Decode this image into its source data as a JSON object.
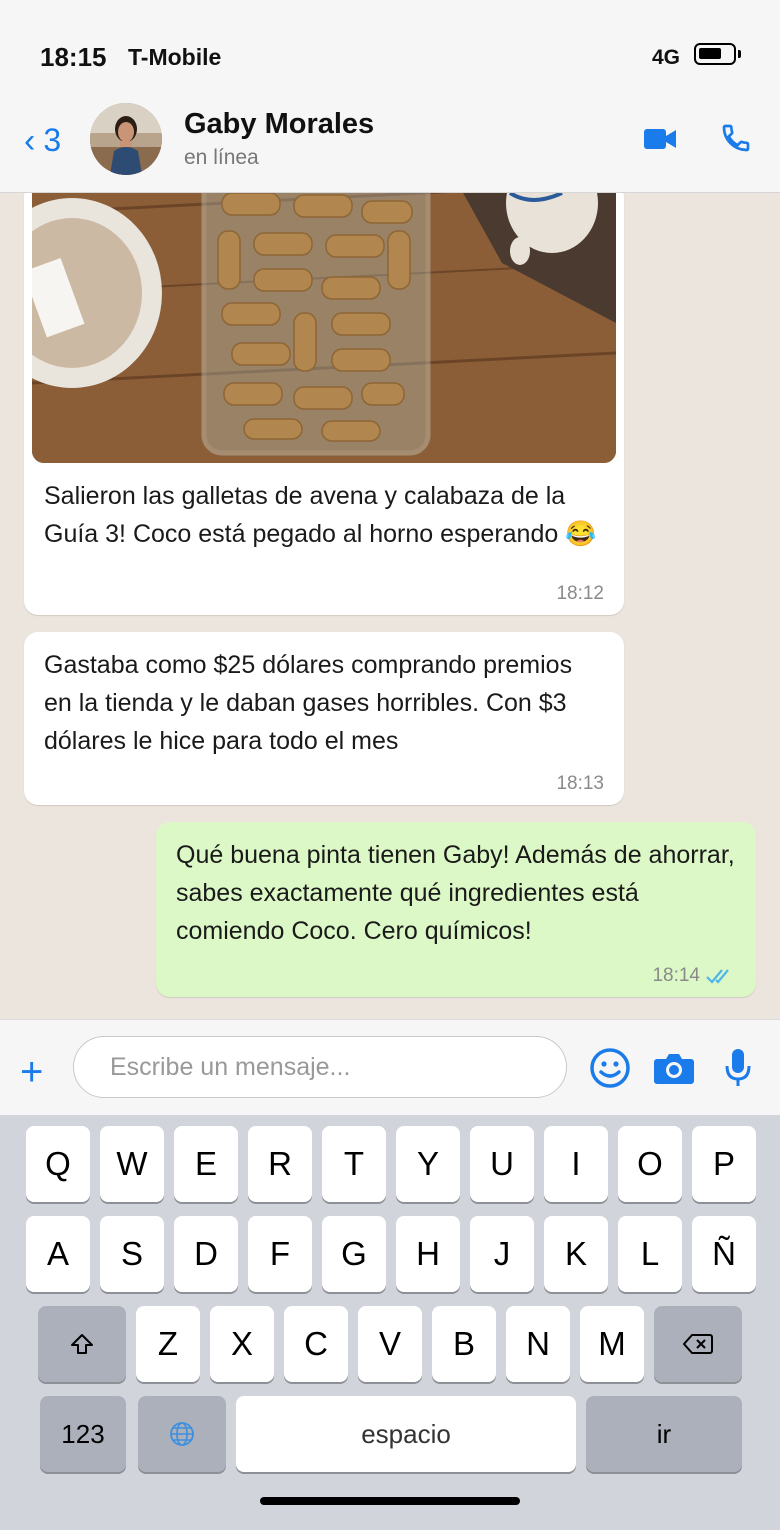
{
  "status_bar": {
    "time": "18:15",
    "carrier": "T-Mobile",
    "network": "4G"
  },
  "header": {
    "back_count": "3",
    "contact_name": "Gaby Morales",
    "contact_status": "en línea"
  },
  "messages": [
    {
      "direction": "incoming",
      "has_image": true,
      "text": "Salieron las galletas de avena y calabaza de la Guía 3! Coco está pegado al horno esperando 😂",
      "time": "18:12"
    },
    {
      "direction": "incoming",
      "text": "Gastaba como $25 dólares comprando premios en la tienda y le daban gases horribles. Con $3 dólares le hice para todo el mes",
      "time": "18:13"
    },
    {
      "direction": "outgoing",
      "text": "Qué buena pinta tienen Gaby! Además de ahorrar, sabes exactamente qué ingredientes está comiendo Coco. Cero químicos!",
      "time": "18:14",
      "read": true
    }
  ],
  "composer": {
    "placeholder": "Escribe un mensaje..."
  },
  "keyboard": {
    "row1": [
      "Q",
      "W",
      "E",
      "R",
      "T",
      "Y",
      "U",
      "I",
      "O",
      "P"
    ],
    "row2": [
      "A",
      "S",
      "D",
      "F",
      "G",
      "H",
      "J",
      "K",
      "L",
      "Ñ"
    ],
    "row3": [
      "Z",
      "X",
      "C",
      "V",
      "B",
      "N",
      "M"
    ],
    "numbers_label": "123",
    "space_label": "espacio",
    "go_label": "ir"
  },
  "colors": {
    "accent": "#1a7bea",
    "outgoing_bubble": "#dcf8c6",
    "chat_bg": "#ece5dd",
    "read_ticks": "#4fb6ec"
  }
}
